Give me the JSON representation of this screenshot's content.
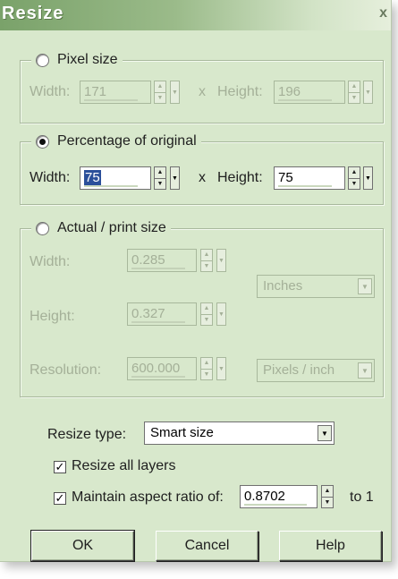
{
  "dialog": {
    "title": "Resize",
    "close": "x"
  },
  "pixel_size": {
    "label": "Pixel size",
    "selected": false,
    "width_label": "Width:",
    "width_value": "171",
    "times": "x",
    "height_label": "Height:",
    "height_value": "196"
  },
  "percentage": {
    "label": "Percentage of original",
    "selected": true,
    "width_label": "Width:",
    "width_value": "75",
    "times": "x",
    "height_label": "Height:",
    "height_value": "75"
  },
  "actual_size": {
    "label": "Actual / print size",
    "selected": false,
    "width_label": "Width:",
    "width_value": "0.285",
    "height_label": "Height:",
    "height_value": "0.327",
    "resolution_label": "Resolution:",
    "resolution_value": "600.000",
    "units": "Inches",
    "resolution_units": "Pixels / inch"
  },
  "resize_type": {
    "label": "Resize type:",
    "value": "Smart size"
  },
  "resize_all_layers": {
    "label": "Resize all layers",
    "checked": true
  },
  "aspect": {
    "label": "Maintain aspect ratio of:",
    "checked": true,
    "value": "0.8702",
    "suffix": "to 1"
  },
  "buttons": {
    "ok": "OK",
    "cancel": "Cancel",
    "help": "Help"
  },
  "icons": {
    "spin_up": "▲",
    "spin_down": "▼",
    "dropdown": "▼",
    "check": "✓"
  }
}
